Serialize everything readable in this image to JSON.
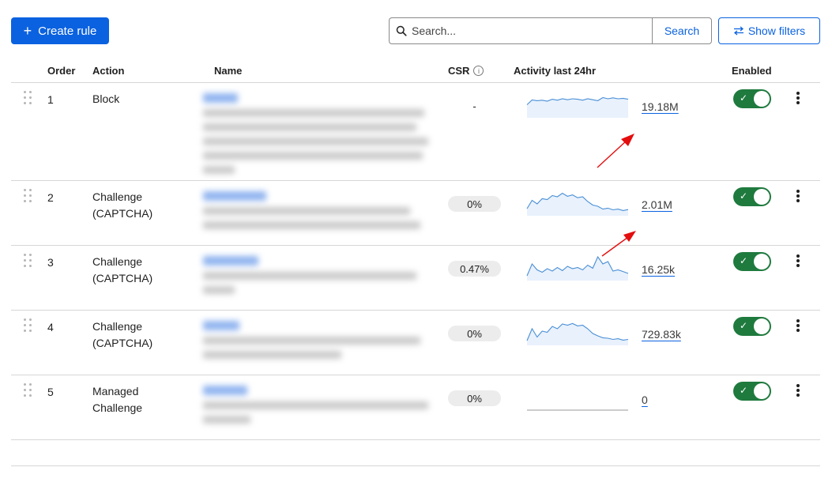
{
  "toolbar": {
    "create_label": "Create rule",
    "search_placeholder": "Search...",
    "search_button": "Search",
    "filters_button": "Show filters"
  },
  "columns": {
    "order": "Order",
    "action": "Action",
    "name": "Name",
    "csr": "CSR",
    "activity": "Activity last 24hr",
    "enabled": "Enabled"
  },
  "rows": [
    {
      "order": "1",
      "action_line1": "Block",
      "action_line2": "",
      "csr": "-",
      "csr_pill": false,
      "count": "19.18M",
      "enabled": true,
      "activity": [
        0.55,
        0.75,
        0.72,
        0.74,
        0.7,
        0.78,
        0.74,
        0.8,
        0.76,
        0.8,
        0.78,
        0.74,
        0.8,
        0.76,
        0.72,
        0.85,
        0.8,
        0.84,
        0.8,
        0.82,
        0.78
      ]
    },
    {
      "order": "2",
      "action_line1": "Challenge",
      "action_line2": "(CAPTCHA)",
      "csr": "0%",
      "csr_pill": true,
      "count": "2.01M",
      "enabled": true,
      "activity": [
        0.3,
        0.65,
        0.5,
        0.72,
        0.68,
        0.85,
        0.8,
        0.95,
        0.82,
        0.88,
        0.76,
        0.8,
        0.6,
        0.45,
        0.4,
        0.28,
        0.32,
        0.25,
        0.28,
        0.22,
        0.26
      ]
    },
    {
      "order": "3",
      "action_line1": "Challenge",
      "action_line2": "(CAPTCHA)",
      "csr": "0.47%",
      "csr_pill": true,
      "count": "16.25k",
      "enabled": true,
      "activity": [
        0.2,
        0.7,
        0.45,
        0.35,
        0.5,
        0.4,
        0.55,
        0.42,
        0.6,
        0.5,
        0.55,
        0.45,
        0.65,
        0.52,
        1.0,
        0.7,
        0.8,
        0.4,
        0.45,
        0.38,
        0.3
      ]
    },
    {
      "order": "4",
      "action_line1": "Challenge",
      "action_line2": "(CAPTCHA)",
      "csr": "0%",
      "csr_pill": true,
      "count": "729.83k",
      "enabled": true,
      "activity": [
        0.2,
        0.7,
        0.35,
        0.6,
        0.55,
        0.8,
        0.7,
        0.9,
        0.85,
        0.92,
        0.82,
        0.85,
        0.7,
        0.5,
        0.4,
        0.32,
        0.3,
        0.25,
        0.28,
        0.22,
        0.25
      ]
    },
    {
      "order": "5",
      "action_line1": "Managed",
      "action_line2": "Challenge",
      "csr": "0%",
      "csr_pill": true,
      "count": "0",
      "enabled": true,
      "activity": [
        0,
        0,
        0,
        0,
        0,
        0,
        0,
        0,
        0,
        0,
        0,
        0,
        0,
        0,
        0,
        0,
        0,
        0,
        0,
        0,
        0
      ]
    }
  ],
  "colors": {
    "accent": "#0b62e0",
    "toggle_on": "#1f7a3e",
    "spark_line": "#4a8fd6",
    "spark_fill": "#e8f1fc",
    "arrow": "#e30d0d"
  }
}
